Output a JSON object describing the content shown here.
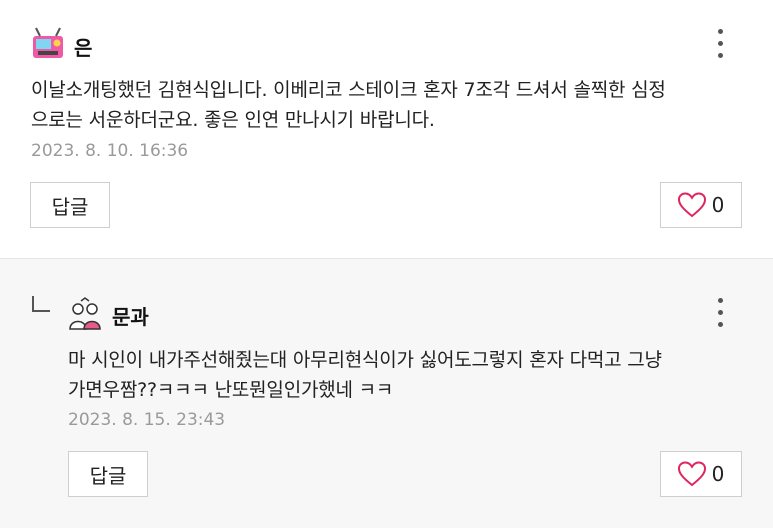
{
  "comments": [
    {
      "author": "은",
      "avatar_icon": "radio-icon",
      "lines": [
        "이날소개팅했던 김현식입니다. 이베리코 스테이크 혼자 7조각 드셔서 솔찍한 심정",
        "으로는 서운하더군요. 좋은 인연 만나시기 바랍니다."
      ],
      "date": "2023. 8. 10. 16:36",
      "reply_label": "답글",
      "like_count": "0"
    },
    {
      "author": "문과",
      "avatar_icon": "people-icon",
      "lines": [
        "마 시인이 내가주선해줬는대 아무리현식이가 싫어도그렇지 혼자 다먹고 그냥",
        "가면우짬??ㅋㅋㅋ 난또뭔일인가했네 ㅋㅋ"
      ],
      "date": "2023. 8. 15. 23:43",
      "reply_label": "답글",
      "like_count": "0"
    }
  ],
  "colors": {
    "heart": "#e0245e",
    "reply_bg": "#f7f7f7",
    "date": "#9a9a9a"
  }
}
